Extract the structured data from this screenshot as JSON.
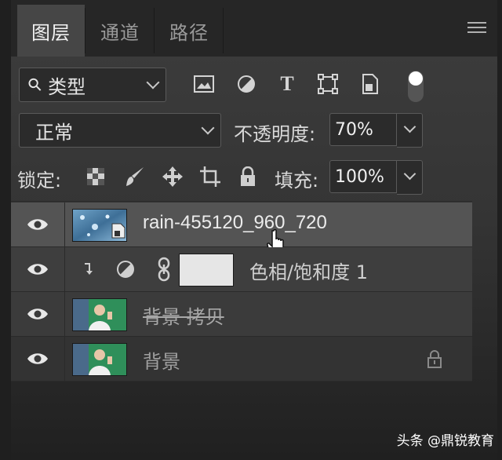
{
  "tabs": [
    {
      "label": "图层",
      "active": true
    },
    {
      "label": "通道",
      "active": false
    },
    {
      "label": "路径",
      "active": false
    }
  ],
  "filter": {
    "search_glyph": "⚲",
    "kind_label": "类型",
    "icons": [
      "image-filter-icon",
      "adjustment-filter-icon",
      "type-filter-icon",
      "shape-filter-icon",
      "smart-object-filter-icon"
    ],
    "type_glyph": "T"
  },
  "blend": {
    "mode": "正常",
    "opacity_label": "不透明度:",
    "opacity_value": "70%"
  },
  "lock": {
    "label": "锁定:",
    "fill_label": "填充:",
    "fill_value": "100%"
  },
  "layers": [
    {
      "name": "rain-455120_960_720",
      "type": "smart-object",
      "selected": true
    },
    {
      "name": "色相/饱和度 1",
      "type": "adjustment",
      "clipped": true
    },
    {
      "name": "背景 拷贝",
      "type": "image",
      "strikethrough": true
    },
    {
      "name": "背景",
      "type": "image",
      "locked": true
    }
  ],
  "watermark": "头条 @鼎锐教育",
  "colors": {
    "panel_bg": "#353535",
    "tab_active": "#464646",
    "text": "#d8d8d8",
    "field_bg": "#2b2b2b"
  }
}
